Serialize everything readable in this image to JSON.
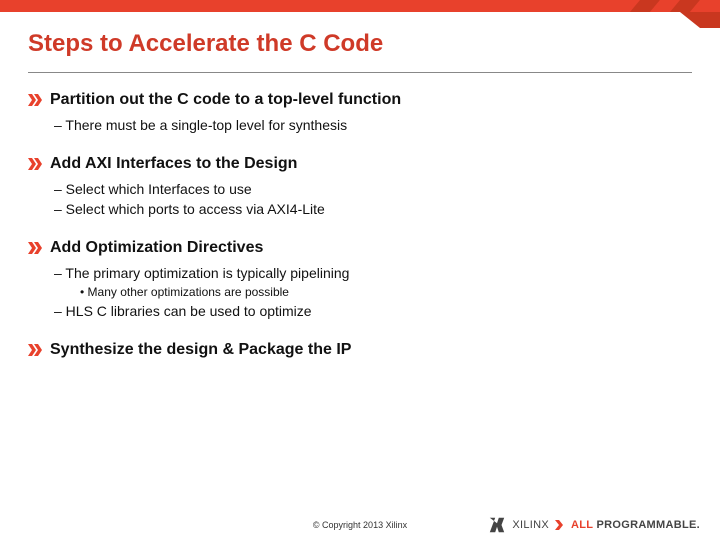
{
  "title": "Steps to Accelerate the C Code",
  "sections": {
    "s0": {
      "head": "Partition out the C code to a top-level function",
      "sub0": "–  There must be a single-top level for synthesis"
    },
    "s1": {
      "head": "Add AXI Interfaces to the Design",
      "sub0": "–  Select which Interfaces to use",
      "sub1": "–  Select which ports to access via AXI4-Lite"
    },
    "s2": {
      "head": "Add Optimization Directives",
      "sub0": "–  The primary optimization is typically pipelining",
      "subsub0": "•  Many other optimizations are possible",
      "sub1": "–  HLS C libraries can be used to optimize"
    },
    "s3": {
      "head": "Synthesize the design & Package the IP"
    }
  },
  "footer": {
    "copyright": "© Copyright 2013 Xilinx"
  },
  "brand": {
    "name": "XILINX",
    "tag_accent": "ALL",
    "tag_rest": " PROGRAMMABLE."
  }
}
